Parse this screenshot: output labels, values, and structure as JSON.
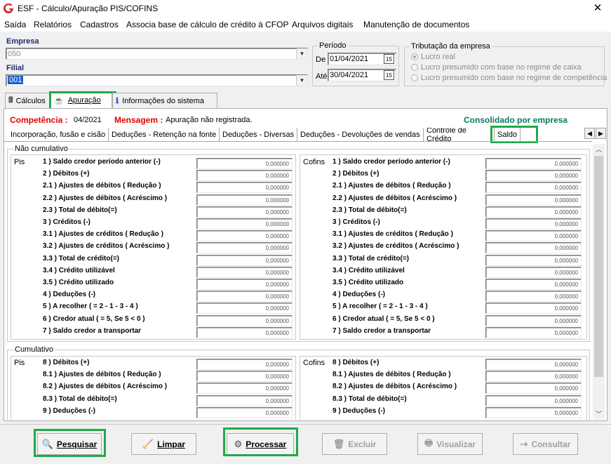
{
  "window": {
    "title": "ESF - Cálculo/Apuração PIS/COFINS",
    "close": "✕"
  },
  "menu": [
    "Saída",
    "Relatórios",
    "Cadastros",
    "Associa base de cálculo de crédito à CFOP",
    "Arquivos digitais",
    "Manutenção de documentos"
  ],
  "empresa": {
    "label": "Empresa",
    "value": "050"
  },
  "filial": {
    "label": "Filial",
    "value": "001"
  },
  "periodo": {
    "title": "Período",
    "de_label": "De",
    "de_value": "01/04/2021",
    "ate_label": "Até",
    "ate_value": "30/04/2021",
    "cal": "15"
  },
  "tributacao": {
    "title": "Tributação da empresa",
    "options": [
      "Lucro real",
      "Lucro presumido com base no regime de caixa",
      "Lucro presumido com base no regime de competência"
    ],
    "selected": 0
  },
  "tabs": [
    "Cálculos",
    "Apuração",
    "Informações do sistema"
  ],
  "header": {
    "competencia_label": "Competência :",
    "competencia_value": "04/2021",
    "mensagem_label": "Mensagem :",
    "mensagem_value": "Apuração não registrada.",
    "consolidado": "Consolidado por empresa"
  },
  "subtabs": [
    "Incorporação, fusão e cisão",
    "Deduções - Retenção na fonte",
    "Deduções - Diversas",
    "Deduções - Devoluções de vendas",
    "Controle de Crédito",
    "Saldo"
  ],
  "nao_cumulativo": {
    "title": "Não cumulativo",
    "pis_label": "Pis",
    "cofins_label": "Cofins",
    "rows": [
      "1 ) Saldo credor período anterior  (-)",
      "2 ) Débitos (+)",
      "2.1 ) Ajustes de débitos ( Redução )",
      "2.2 ) Ajustes de débitos ( Acréscimo )",
      "2.3 ) Total de débito(=)",
      "3 ) Créditos (-)",
      "3.1 ) Ajustes de créditos ( Redução )",
      "3.2 ) Ajustes de créditos ( Acréscimo )",
      "3.3 ) Total de crédito(=)",
      "3.4 ) Crédito utilizável",
      "3.5 ) Crédito utilizado",
      "4 ) Deduções (-)",
      "5 ) A recolher ( = 2 - 1 - 3 - 4 )",
      "6 ) Credor atual ( = 5, Se 5 < 0 )",
      "7 ) Saldo credor a transportar"
    ],
    "value": "0,000000"
  },
  "cumulativo": {
    "title": "Cumulativo",
    "pis_label": "Pis",
    "cofins_label": "Cofins",
    "rows": [
      "8 ) Débitos (+)",
      "8.1 ) Ajustes de débitos ( Redução )",
      "8.2 ) Ajustes de débitos ( Acréscimo )",
      "8.3 ) Total de débito(=)",
      "9 ) Deduções (-)"
    ],
    "value": "0,000000"
  },
  "buttons": {
    "pesquisar": "Pesquisar",
    "limpar": "Limpar",
    "processar": "Processar",
    "excluir": "Excluir",
    "visualizar": "Visualizar",
    "consultar": "Consultar"
  },
  "colors": {
    "accent_red": "#e00000",
    "accent_green": "#0a7a5a",
    "highlight": "#22a84a"
  }
}
